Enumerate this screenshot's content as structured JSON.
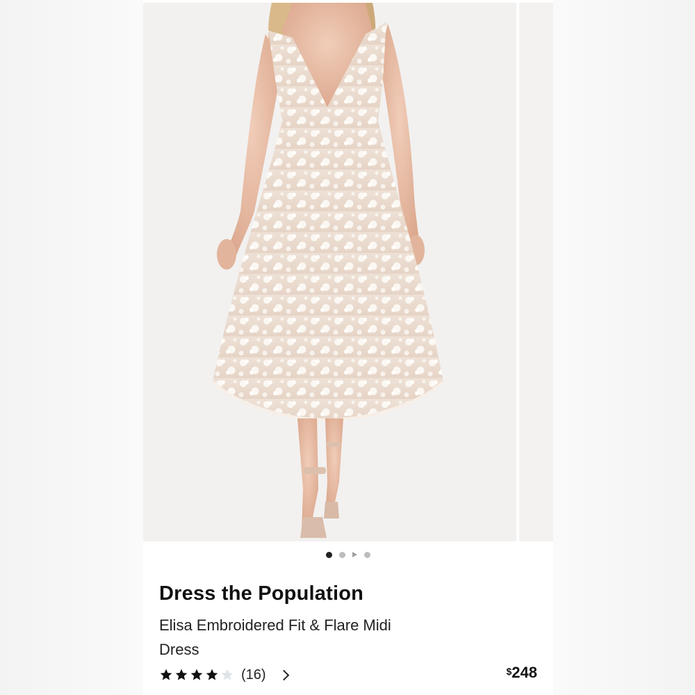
{
  "product": {
    "brand": "Dress the Population",
    "name": "Elisa Embroidered Fit & Flare Midi Dress",
    "rating": {
      "stars_filled": 4,
      "stars_total": 5,
      "count_label": "(16)"
    },
    "price": {
      "currency_symbol": "$",
      "amount": "248"
    }
  },
  "gallery": {
    "image_count": 4,
    "active_index": 0,
    "video_indicator_index": 2
  },
  "colors": {
    "dot_active": "#222222",
    "dot_inactive": "#bdbdbd",
    "star_filled": "#111111",
    "star_empty": "#dde4e8"
  },
  "icons": {
    "star": "star-icon",
    "play": "play-icon",
    "chevron": "chevron-right-icon"
  }
}
